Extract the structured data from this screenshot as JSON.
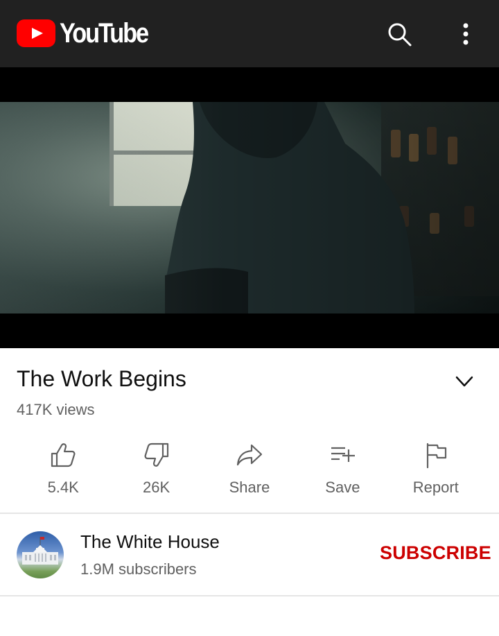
{
  "app": {
    "logo_text": "YouTube",
    "brand_color": "#ff0000",
    "topbar_color": "#212121",
    "icons": [
      "search-icon",
      "more-vert-icon"
    ]
  },
  "video": {
    "title": "The Work Begins",
    "views": "417K views",
    "expand_icon": "chevron-down-icon"
  },
  "actions": [
    {
      "name": "like",
      "icon": "thumbs-up-icon",
      "label": "5.4K"
    },
    {
      "name": "dislike",
      "icon": "thumbs-down-icon",
      "label": "26K"
    },
    {
      "name": "share",
      "icon": "share-icon",
      "label": "Share"
    },
    {
      "name": "save",
      "icon": "playlist-add-icon",
      "label": "Save"
    },
    {
      "name": "report",
      "icon": "flag-icon",
      "label": "Report"
    }
  ],
  "channel": {
    "name": "The White House",
    "subscribers": "1.9M subscribers",
    "subscribe_label": "SUBSCRIBE",
    "subscribe_color": "#cc0000"
  }
}
